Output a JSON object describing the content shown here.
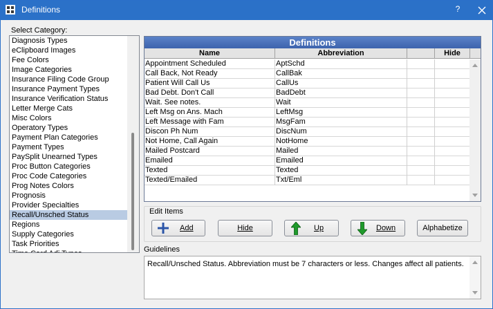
{
  "window": {
    "title": "Definitions",
    "help": "?"
  },
  "select_category_label": "Select Category:",
  "categories": [
    "Diagnosis Types",
    "eClipboard Images",
    "Fee Colors",
    "Image Categories",
    "Insurance Filing Code Group",
    "Insurance Payment Types",
    "Insurance Verification Status",
    "Letter Merge Cats",
    "Misc Colors",
    "Operatory Types",
    "Payment Plan Categories",
    "Payment Types",
    "PaySplit Unearned Types",
    "Proc Button Categories",
    "Proc Code Categories",
    "Prog Notes Colors",
    "Prognosis",
    "Provider Specialties",
    "Recall/Unsched Status",
    "Regions",
    "Supply Categories",
    "Task Priorities",
    "Time Card Adj Types"
  ],
  "selected_category": "Recall/Unsched Status",
  "grid": {
    "title": "Definitions",
    "columns": {
      "name": "Name",
      "abbreviation": "Abbreviation",
      "extra": "",
      "hide": "Hide"
    },
    "rows": [
      {
        "name": "Appointment Scheduled",
        "abbreviation": "AptSchd"
      },
      {
        "name": "Call Back, Not Ready",
        "abbreviation": "CallBak"
      },
      {
        "name": "Patient Will Call Us",
        "abbreviation": "CallUs"
      },
      {
        "name": "Bad Debt. Don't Call",
        "abbreviation": "BadDebt"
      },
      {
        "name": "Wait. See notes.",
        "abbreviation": "Wait"
      },
      {
        "name": "Left Msg on Ans. Mach",
        "abbreviation": "LeftMsg"
      },
      {
        "name": "Left Message with Fam",
        "abbreviation": "MsgFam"
      },
      {
        "name": "Discon Ph Num",
        "abbreviation": "DiscNum"
      },
      {
        "name": "Not Home, Call Again",
        "abbreviation": "NotHome"
      },
      {
        "name": "Mailed Postcard",
        "abbreviation": "Mailed"
      },
      {
        "name": "Emailed",
        "abbreviation": "Emailed"
      },
      {
        "name": "Texted",
        "abbreviation": "Texted"
      },
      {
        "name": "Texted/Emailed",
        "abbreviation": "Txt/Eml"
      }
    ]
  },
  "edit_items": {
    "label": "Edit Items",
    "buttons": {
      "add": "Add",
      "hide": "Hide",
      "up": "Up",
      "down": "Down",
      "alphabetize": "Alphabetize"
    }
  },
  "guidelines": {
    "label": "Guidelines",
    "text": "Recall/Unsched Status.  Abbreviation must be 7 characters or less.  Changes affect all patients."
  },
  "colors": {
    "titlebar": "#2b71c8",
    "grid_header": "#4a72bb",
    "selection": "#b9cbe3",
    "up_arrow": "#1f9a2b",
    "add_plus": "#2b55a8"
  }
}
